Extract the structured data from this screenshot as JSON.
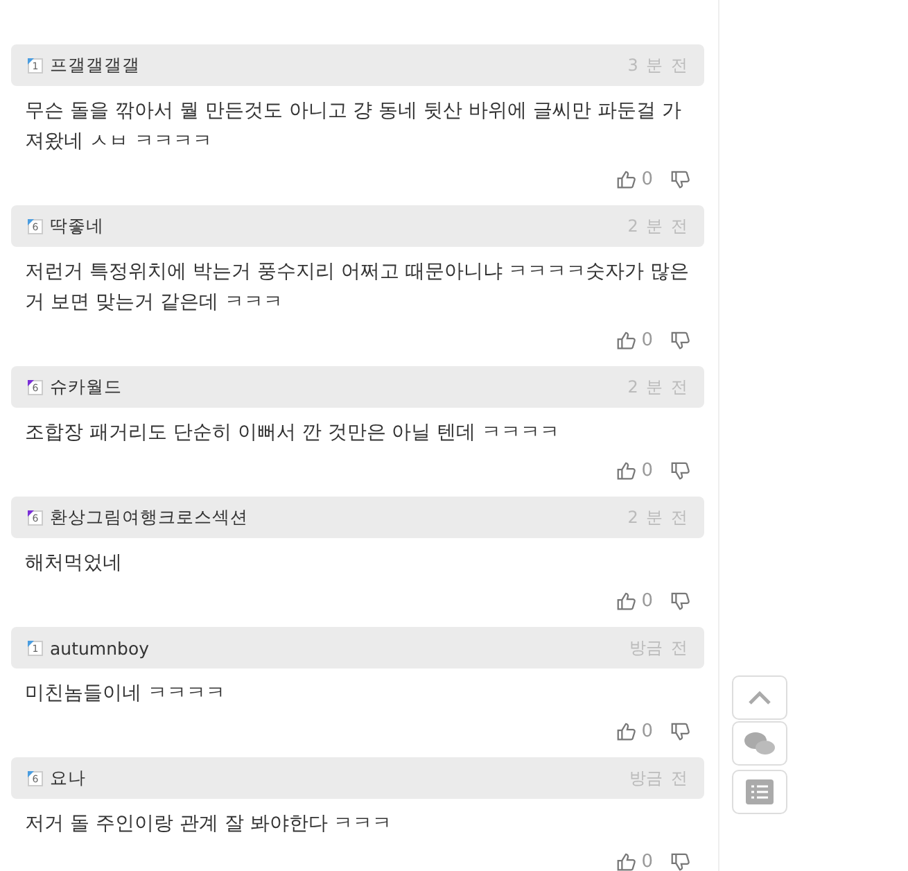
{
  "comments": [
    {
      "user": "프갤갤갤갤",
      "badge": "1",
      "color": "#4a9de0",
      "time": "3 분 전",
      "text": "무슨 돌을 깎아서 뭘 만든것도 아니고 걍 동네 뒷산 바위에 글씨만 파둔걸 가져왔네 ㅅㅂ ㅋㅋㅋㅋ",
      "likes": "0"
    },
    {
      "user": "딱좋네",
      "badge": "6",
      "color": "#4a9de0",
      "time": "2 분 전",
      "text": "저런거 특정위치에 박는거 풍수지리 어쩌고 때문아니냐 ㅋㅋㅋㅋ숫자가 많은거 보면 맞는거 같은데 ㅋㅋㅋ",
      "likes": "0"
    },
    {
      "user": "슈카월드",
      "badge": "6",
      "color": "#7a2fd8",
      "time": "2 분 전",
      "text": "조합장 패거리도 단순히 이뻐서 깐 것만은 아닐 텐데 ㅋㅋㅋㅋ",
      "likes": "0"
    },
    {
      "user": "환상그림여행크로스섹션",
      "badge": "6",
      "color": "#7a2fd8",
      "time": "2 분 전",
      "text": "해처먹었네",
      "likes": "0"
    },
    {
      "user": "autumnboy",
      "badge": "1",
      "color": "#4a9de0",
      "time": "방금 전",
      "text": "미친놈들이네 ㅋㅋㅋㅋ",
      "likes": "0"
    },
    {
      "user": "요나",
      "badge": "6",
      "color": "#4a9de0",
      "time": "방금 전",
      "text": "저거 돌 주인이랑 관계 잘 봐야한다 ㅋㅋㅋ",
      "likes": "0"
    }
  ]
}
